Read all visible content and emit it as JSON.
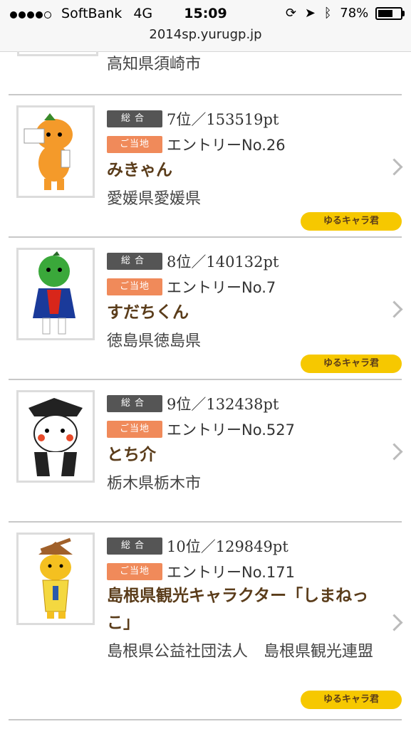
{
  "status_bar": {
    "carrier": "SoftBank",
    "network": "4G",
    "time": "15:09",
    "battery": "78%",
    "battery_level": 0.78,
    "url": "2014sp.yurugp.jp"
  },
  "partial_item": {
    "location": "高知県須崎市"
  },
  "items": [
    {
      "rank": "7位／153519pt",
      "entry": "エントリーNo.26",
      "name": "みきゃん",
      "location": "愛媛県愛媛県",
      "tag": "ゆるキャラ君",
      "total_badge": "総合",
      "local_badge": "ご当地"
    },
    {
      "rank": "8位／140132pt",
      "entry": "エントリーNo.7",
      "name": "すだちくん",
      "location": "徳島県徳島県",
      "tag": "ゆるキャラ君",
      "total_badge": "総合",
      "local_badge": "ご当地"
    },
    {
      "rank": "9位／132438pt",
      "entry": "エントリーNo.527",
      "name": "とち介",
      "location": "栃木県栃木市",
      "tag": "",
      "total_badge": "総合",
      "local_badge": "ご当地"
    },
    {
      "rank": "10位／129849pt",
      "entry": "エントリーNo.171",
      "name": "島根県観光キャラクター「しまねっこ」",
      "location": "島根県公益社団法人　島根県観光連盟",
      "tag": "ゆるキャラ君",
      "total_badge": "総合",
      "local_badge": "ご当地"
    }
  ],
  "colors": {
    "tag_yellow": "#f6c800",
    "badge_gray": "#555555",
    "badge_orange": "#f08a5a",
    "name_brown": "#5a3c1a"
  }
}
